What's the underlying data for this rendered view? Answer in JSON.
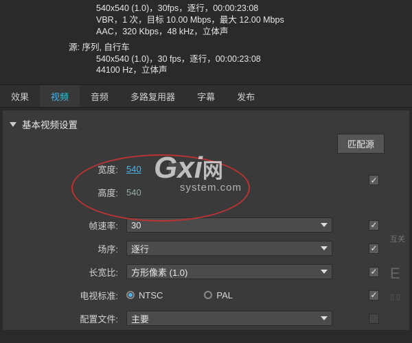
{
  "info": {
    "line1": "540x540 (1.0)，30fps，逐行，00:00:23:08",
    "line2": "VBR，1 次，目标 10.00 Mbps，最大 12.00 Mbps",
    "line3": "AAC，320 Kbps，48  kHz，立体声",
    "src_label": "源: ",
    "src_name": "序列, 自行车",
    "src_line1": "540x540 (1.0)，30 fps，逐行，00:00:23:08",
    "src_line2": "44100 Hz，立体声"
  },
  "tabs": {
    "t0": "效果",
    "t1": "视频",
    "t2": "音频",
    "t3": "多路复用器",
    "t4": "字幕",
    "t5": "发布"
  },
  "section": {
    "title": "基本视频设置"
  },
  "buttons": {
    "match": "匹配源"
  },
  "labels": {
    "width": "宽度:",
    "height": "高度:",
    "fps": "帧速率:",
    "order": "场序:",
    "aspect": "长宽比:",
    "tvstd": "电视标准:",
    "profile": "配置文件:"
  },
  "values": {
    "width": "540",
    "height": "540",
    "fps": "30",
    "order": "逐行",
    "aspect": "方形像素 (1.0)",
    "profile": "主要"
  },
  "tv": {
    "ntsc": "NTSC",
    "pal": "PAL"
  },
  "watermark": {
    "big": "Gxi",
    "suffix": "网",
    "sub": "system.com"
  },
  "side": {
    "btn": "互关"
  }
}
